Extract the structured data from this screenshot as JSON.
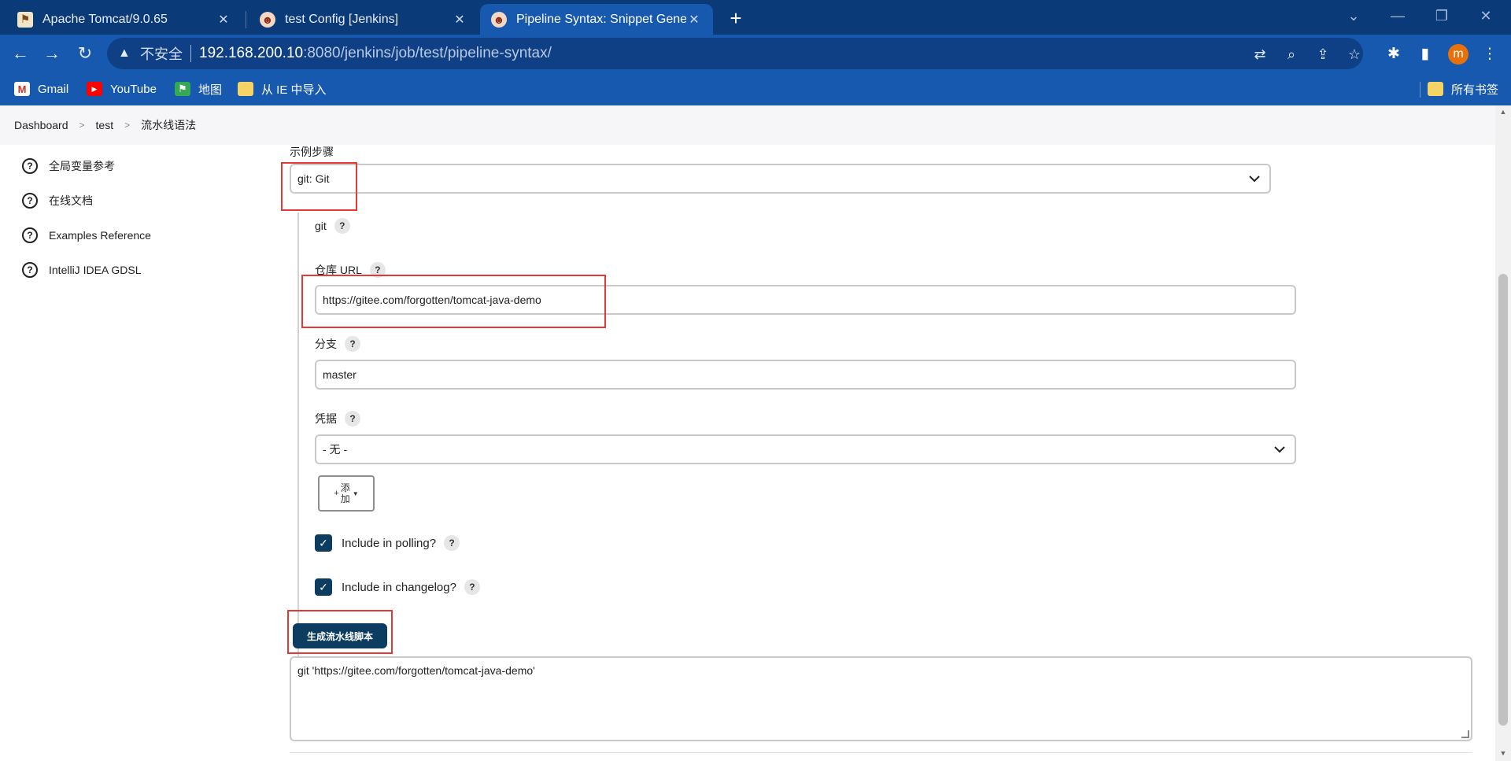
{
  "tabs": [
    {
      "title": "Apache Tomcat/9.0.65",
      "icon": "tomcat-icon"
    },
    {
      "title": "test Config [Jenkins]",
      "icon": "jenkins-icon"
    },
    {
      "title": "Pipeline Syntax: Snippet Gene",
      "icon": "jenkins-icon"
    }
  ],
  "address": {
    "insecure_label": "不安全",
    "host": "192.168.200.10",
    "path": ":8080/jenkins/job/test/pipeline-syntax/"
  },
  "profile_initial": "m",
  "bookmarks": [
    {
      "label": "Gmail",
      "icon": "gmail-icon"
    },
    {
      "label": "YouTube",
      "icon": "youtube-icon"
    },
    {
      "label": "地图",
      "icon": "maps-icon"
    },
    {
      "label": "从 IE 中导入",
      "icon": "folder-icon"
    }
  ],
  "all_bookmarks_label": "所有书签",
  "breadcrumb": [
    "Dashboard",
    "test",
    "流水线语法"
  ],
  "sidebar": [
    {
      "label": "全局变量参考"
    },
    {
      "label": "在线文档"
    },
    {
      "label": "Examples Reference"
    },
    {
      "label": "IntelliJ IDEA GDSL"
    }
  ],
  "form": {
    "sample_step_label": "示例步骤",
    "sample_step_value": "git: Git",
    "git_label": "git",
    "repo_url_label": "仓库 URL",
    "repo_url_value": "https://gitee.com/forgotten/tomcat-java-demo",
    "branch_label": "分支",
    "branch_value": "master",
    "credentials_label": "凭据",
    "credentials_value": "- 无 -",
    "add_button_line1": "添",
    "add_button_line2": "加",
    "include_polling_label": "Include in polling?",
    "include_changelog_label": "Include in changelog?",
    "generate_button_label": "生成流水线脚本",
    "output_value": "git 'https://gitee.com/forgotten/tomcat-java-demo'",
    "help_glyph": "?"
  },
  "colors": {
    "tabstrip": "#0b3a78",
    "toolbar": "#1859b0",
    "jenkins_primary": "#0d3c61",
    "highlight_red": "#e53935"
  }
}
